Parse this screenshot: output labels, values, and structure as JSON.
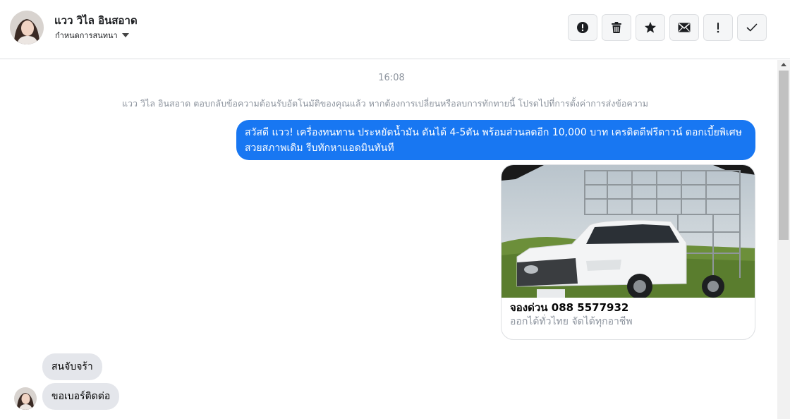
{
  "contact": {
    "name": "แวว วิไล อินสอาด",
    "subtitle": "กำหนดการสนทนา"
  },
  "header_actions": [
    {
      "icon": "alert-circle-icon",
      "name": "mark-spam-button"
    },
    {
      "icon": "trash-icon",
      "name": "delete-button"
    },
    {
      "icon": "star-icon",
      "name": "star-button"
    },
    {
      "icon": "envelope-icon",
      "name": "mark-unread-button"
    },
    {
      "icon": "exclamation-icon",
      "name": "follow-up-button"
    },
    {
      "icon": "checkmark-icon",
      "name": "mark-done-button"
    }
  ],
  "thread": {
    "timestamp": "16:08",
    "notice": "แวว วิไล อินสอาด ตอบกลับข้อความต้อนรับอัตโนมัติของคุณแล้ว หากต้องการเปลี่ยนหรือลบการทักทายนี้ โปรดไปที่การตั้งค่าการส่งข้อความ",
    "outgoing_message": "สวัสดี แวว!  เครื่องทนทาน ประหยัดน้ำมัน ดันได้ 4-5ตัน พร้อมส่วนลดอีก 10,000 บาท เครดิตดีฟรีดาวน์ ดอกเบี้ยพิเศษ สวยสภาพเดิม รีบทักหาแอดมินทันที",
    "card": {
      "title": "จองด่วน 088 5577932",
      "subtitle": "ออกได้ทั่วไทย จัดได้ทุกอาชีพ"
    },
    "incoming_messages": [
      "สนจับจร้า",
      "ขอเบอร์ติดต่อ"
    ]
  },
  "colors": {
    "accent": "#1877f2",
    "incoming_bubble": "#e4e6eb",
    "muted_text": "#8d949e"
  }
}
